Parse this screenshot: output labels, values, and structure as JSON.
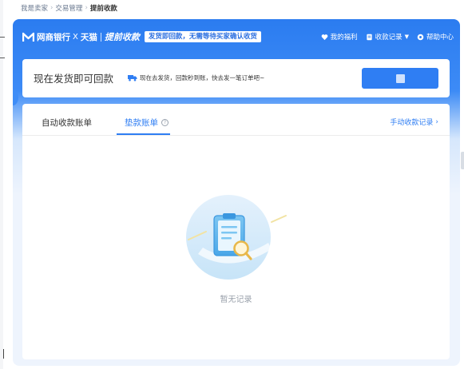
{
  "breadcrumb": {
    "items": [
      "我是卖家",
      "交易管理",
      "提前收款"
    ]
  },
  "header": {
    "brand_name": "网商银行",
    "brand_x": "X",
    "partner": "天猫",
    "product": "提前收款",
    "slogan": "发货即回款，无需等待买家确认收货",
    "nav": {
      "welfare": "我的福利",
      "records": "收款记录",
      "help": "帮助中心"
    }
  },
  "promo": {
    "title": "现在发货即可回款",
    "subtitle": "现在去发货，回款秒到账，快去发一笔订单吧~"
  },
  "tabs": {
    "auto": "自动收款账单",
    "advance": "垫款账单",
    "help_glyph": "?",
    "manual_link": "手动收款记录"
  },
  "empty_state": {
    "text": "暂无记录"
  },
  "colors": {
    "primary": "#2f7ef3",
    "frame_top": "#2b7cf0",
    "frame_bottom": "#eef4fd",
    "text": "#333333",
    "muted": "#9aa1ab"
  },
  "icons": [
    "logo-icon",
    "heart-icon",
    "doc-icon",
    "caret-down-icon",
    "gear-icon",
    "truck-icon",
    "help-circle-icon",
    "chevron-right-icon",
    "clipboard-search-icon"
  ]
}
